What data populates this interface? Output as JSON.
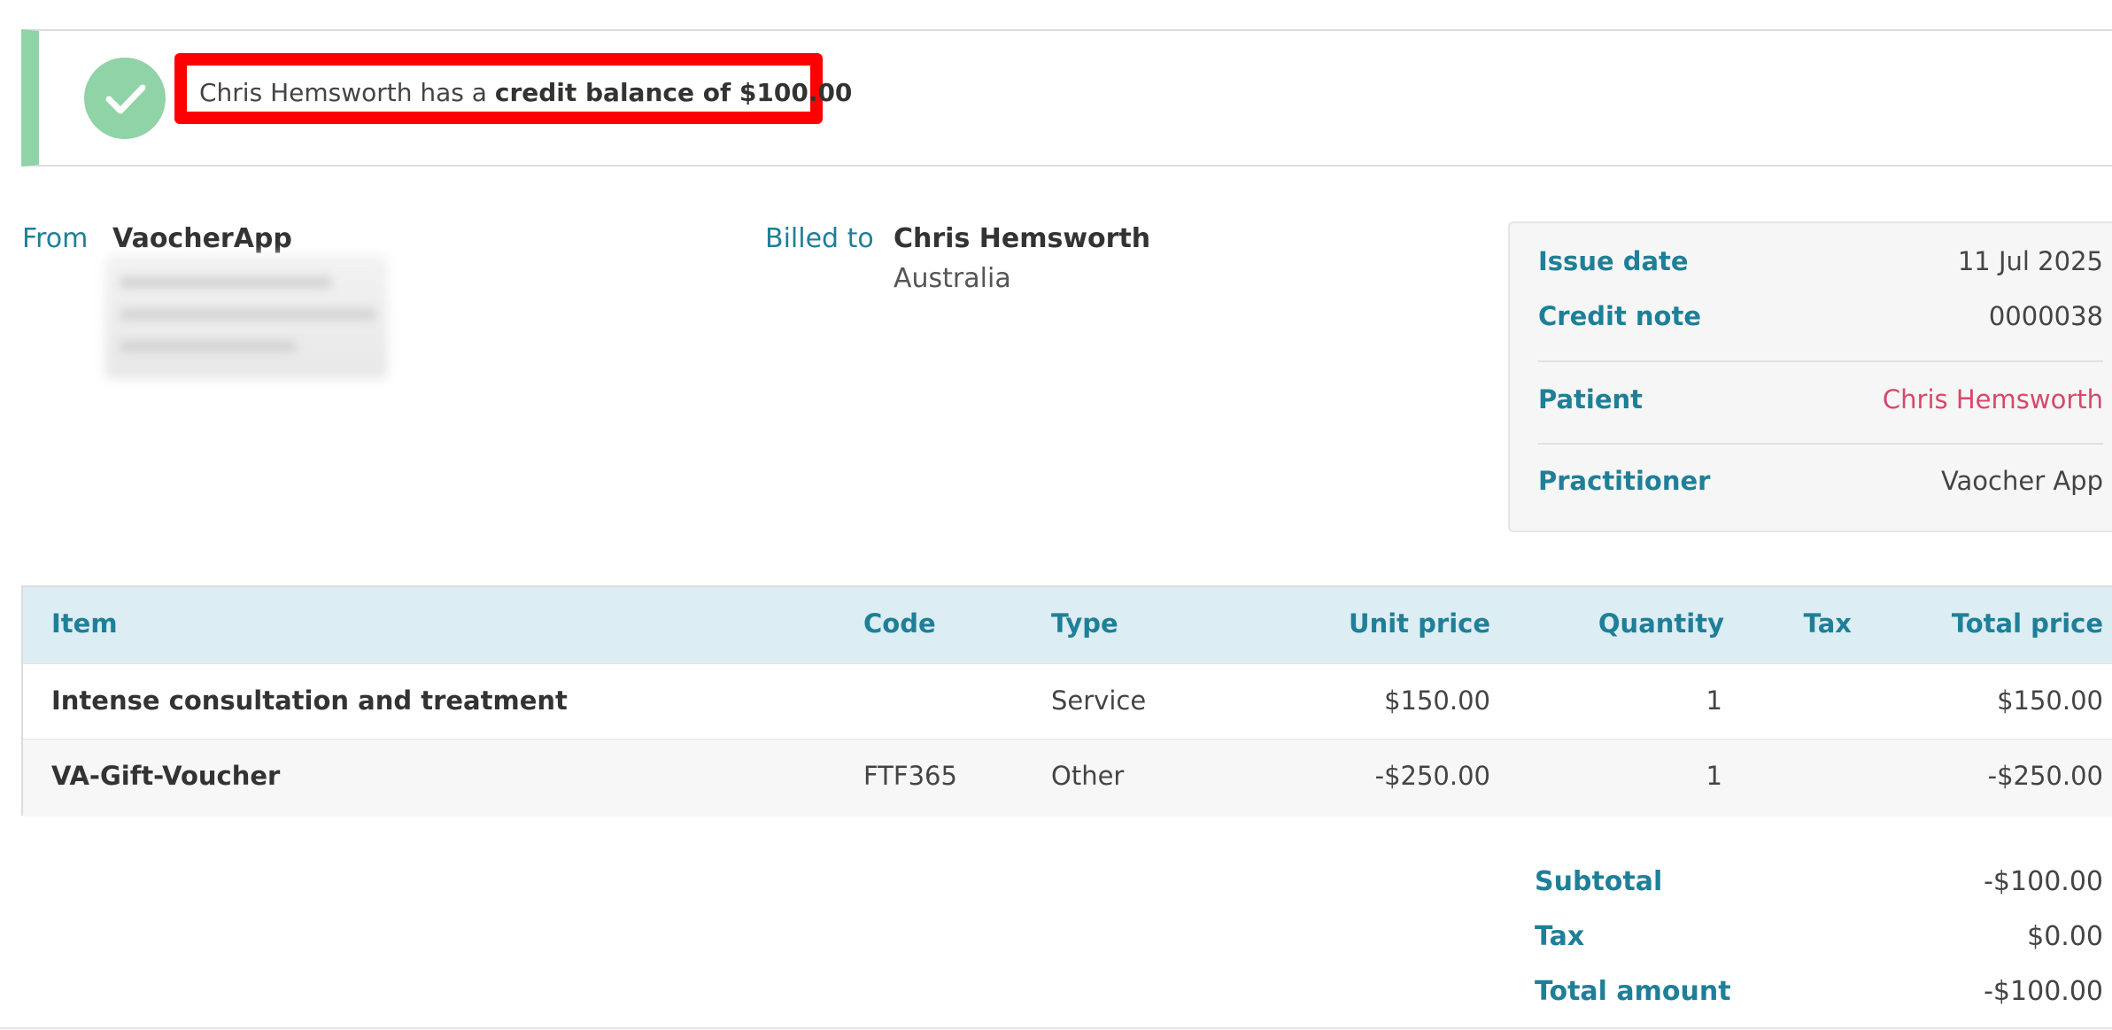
{
  "banner": {
    "prefix": "Chris Hemsworth has a ",
    "emphasis": "credit balance of $100.00",
    "accent_color": "#8fd3a6",
    "highlight_color": "#ff0000"
  },
  "from": {
    "label": "From",
    "name": "VaocherApp"
  },
  "billed_to": {
    "label": "Billed to",
    "name": "Chris Hemsworth",
    "country": "Australia"
  },
  "meta": {
    "issue_date": {
      "label": "Issue date",
      "value": "11 Jul 2025"
    },
    "credit_note": {
      "label": "Credit note",
      "value": "0000038"
    },
    "patient": {
      "label": "Patient",
      "value": "Chris Hemsworth",
      "color": "#d9476b"
    },
    "practitioner": {
      "label": "Practitioner",
      "value": "Vaocher App"
    }
  },
  "table": {
    "headers": {
      "item": "Item",
      "code": "Code",
      "type": "Type",
      "unit_price": "Unit price",
      "quantity": "Quantity",
      "tax": "Tax",
      "total_price": "Total price"
    },
    "rows": [
      {
        "item": "Intense consultation and treatment",
        "code": "",
        "type": "Service",
        "unit_price": "$150.00",
        "quantity": "1",
        "tax": "",
        "total_price": "$150.00"
      },
      {
        "item": "VA-Gift-Voucher",
        "code": "FTF365",
        "type": "Other",
        "unit_price": "-$250.00",
        "quantity": "1",
        "tax": "",
        "total_price": "-$250.00"
      }
    ]
  },
  "totals": {
    "subtotal": {
      "label": "Subtotal",
      "value": "-$100.00"
    },
    "tax": {
      "label": "Tax",
      "value": "$0.00"
    },
    "total_amount": {
      "label": "Total amount",
      "value": "-$100.00"
    }
  },
  "icons": {
    "status": "check-icon"
  }
}
